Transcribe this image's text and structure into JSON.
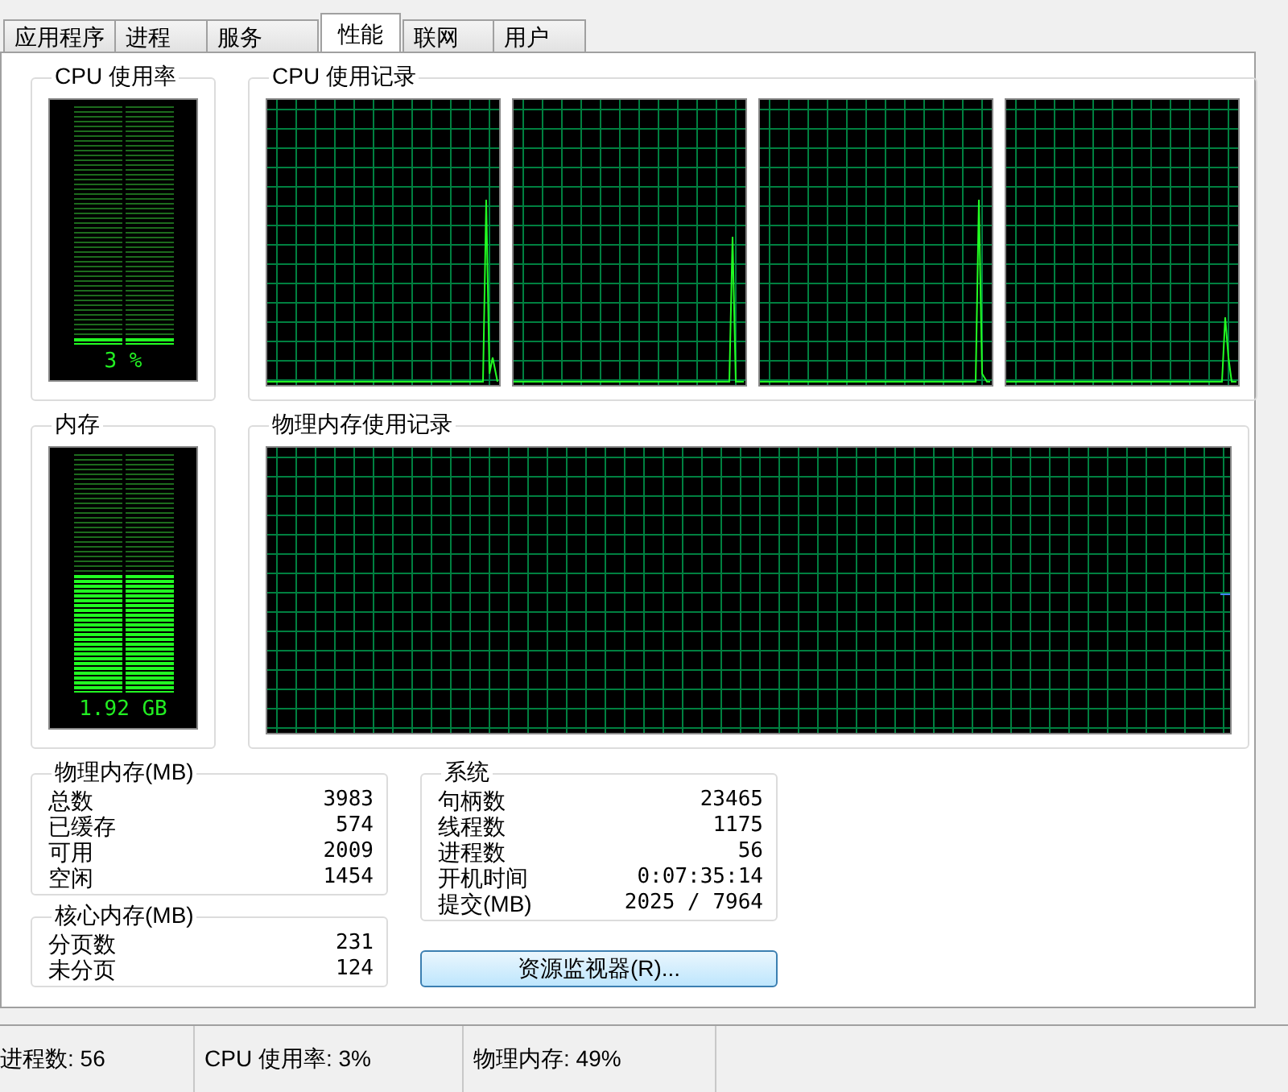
{
  "tabs": [
    {
      "label": "应用程序",
      "selected": false
    },
    {
      "label": "进程",
      "selected": false
    },
    {
      "label": "服务",
      "selected": false
    },
    {
      "label": "性能",
      "selected": true
    },
    {
      "label": "联网",
      "selected": false
    },
    {
      "label": "用户",
      "selected": false
    }
  ],
  "cpu_usage": {
    "title": "CPU 使用率",
    "level": 0.03,
    "reading": "3 %"
  },
  "cpu_history": {
    "title": "CPU 使用记录"
  },
  "memory": {
    "title": "内存",
    "level": 0.49,
    "reading": "1.92 GB"
  },
  "memory_history": {
    "title": "物理内存使用记录"
  },
  "physical_memory": {
    "title": "物理内存(MB)",
    "rows": [
      {
        "label": "总数",
        "value": "3983"
      },
      {
        "label": "已缓存",
        "value": "574"
      },
      {
        "label": "可用",
        "value": "2009"
      },
      {
        "label": "空闲",
        "value": "1454"
      }
    ]
  },
  "kernel_memory": {
    "title": "核心内存(MB)",
    "rows": [
      {
        "label": "分页数",
        "value": "231"
      },
      {
        "label": "未分页",
        "value": "124"
      }
    ]
  },
  "system": {
    "title": "系统",
    "rows": [
      {
        "label": "句柄数",
        "value": "23465"
      },
      {
        "label": "线程数",
        "value": "1175"
      },
      {
        "label": "进程数",
        "value": "56"
      },
      {
        "label": "开机时间",
        "value": "0:07:35:14"
      },
      {
        "label": "提交(MB)",
        "value": "2025 / 7964"
      }
    ]
  },
  "resource_monitor_button": "资源监视器(R)...",
  "status_bar": [
    "进程数: 56",
    "CPU 使用率: 3%",
    "物理内存: 49%"
  ]
}
